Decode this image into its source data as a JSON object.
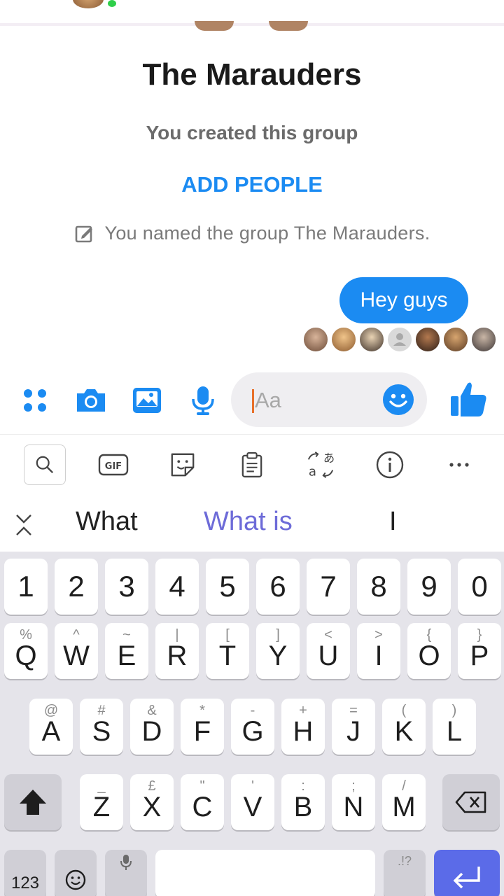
{
  "conversation": {
    "title": "The Marauders",
    "subtitle": "You created this group",
    "add_people": "ADD PEOPLE",
    "named_note": "You named the group The Marauders.",
    "message": "Hey guys"
  },
  "composer": {
    "placeholder": "Aa"
  },
  "keyboard": {
    "suggestions": [
      "What",
      "What is",
      "I"
    ],
    "numbers": [
      "1",
      "2",
      "3",
      "4",
      "5",
      "6",
      "7",
      "8",
      "9",
      "0"
    ],
    "row1": [
      {
        "k": "Q",
        "a": "%"
      },
      {
        "k": "W",
        "a": "^"
      },
      {
        "k": "E",
        "a": "~"
      },
      {
        "k": "R",
        "a": "|"
      },
      {
        "k": "T",
        "a": "["
      },
      {
        "k": "Y",
        "a": "]"
      },
      {
        "k": "U",
        "a": "<"
      },
      {
        "k": "I",
        "a": ">"
      },
      {
        "k": "O",
        "a": "{"
      },
      {
        "k": "P",
        "a": "}"
      }
    ],
    "row2": [
      {
        "k": "A",
        "a": "@"
      },
      {
        "k": "S",
        "a": "#"
      },
      {
        "k": "D",
        "a": "&"
      },
      {
        "k": "F",
        "a": "*"
      },
      {
        "k": "G",
        "a": "-"
      },
      {
        "k": "H",
        "a": "+"
      },
      {
        "k": "J",
        "a": "="
      },
      {
        "k": "K",
        "a": "("
      },
      {
        "k": "L",
        "a": ")"
      }
    ],
    "row3": [
      {
        "k": "Z",
        "a": "_"
      },
      {
        "k": "X",
        "a": "£"
      },
      {
        "k": "C",
        "a": "\""
      },
      {
        "k": "V",
        "a": "'"
      },
      {
        "k": "B",
        "a": ":"
      },
      {
        "k": "N",
        "a": ";"
      },
      {
        "k": "M",
        "a": "/"
      }
    ],
    "symbols_key": "123",
    "punct_key": ".!?"
  },
  "colors": {
    "accent": "#1b8bf2",
    "suggestion_highlight": "#6d6bd8",
    "enter_key": "#5b6be8"
  }
}
